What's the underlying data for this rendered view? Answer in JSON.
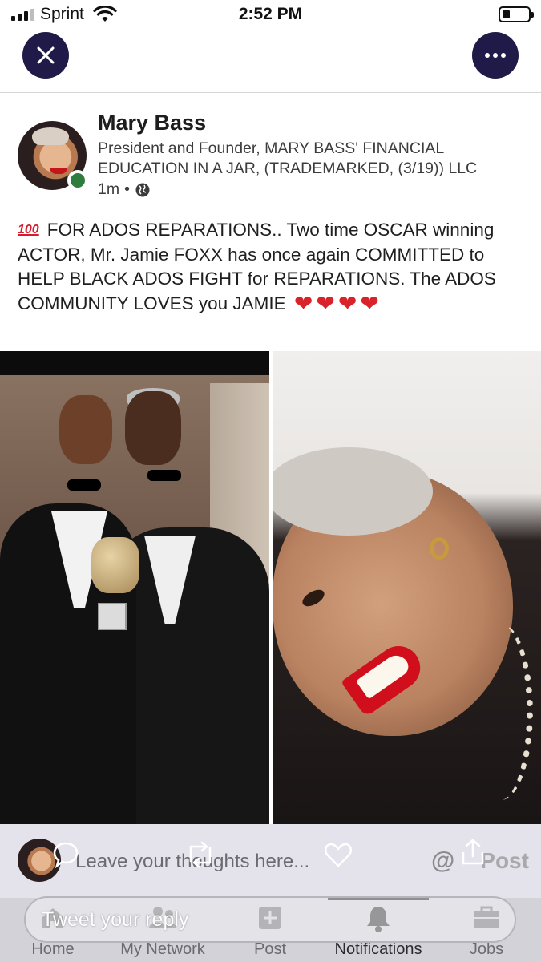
{
  "status_bar": {
    "carrier": "Sprint",
    "time": "2:52 PM",
    "icons": [
      "signal-icon",
      "wifi-icon",
      "battery-icon"
    ]
  },
  "nav": {
    "close_icon": "close-icon",
    "more_icon": "more-horizontal-icon"
  },
  "post": {
    "author": {
      "name": "Mary Bass",
      "headline": "President and Founder, MARY BASS' FINANCIAL EDUCATION IN A JAR, (TRADEMARKED, (3/19)) LLC",
      "time": "1m",
      "separator": "•",
      "visibility_icon": "globe-icon",
      "online": true
    },
    "emoji_100": "100",
    "text": "FOR ADOS REPARATIONS.. Two time OSCAR winning ACTOR, Mr. Jamie FOXX has once again COMMITTED to HELP BLACK ADOS FIGHT for REPARATIONS. The ADOS COMMUNITY LOVES you JAMIE",
    "hearts": [
      "❤",
      "❤",
      "❤",
      "❤"
    ],
    "images": [
      "photo-two-men-in-tuxedos-with-award",
      "photo-smiling-woman-closeup"
    ]
  },
  "actions": {
    "comment_placeholder": "Leave your thoughts here...",
    "mention_symbol": "@",
    "post_label": "Post",
    "icons": [
      "comment-icon",
      "retweet-icon",
      "like-heart-icon",
      "share-icon"
    ]
  },
  "reply": {
    "placeholder": "Tweet your reply"
  },
  "bottom_nav": {
    "items": [
      {
        "label": "Home",
        "icon": "home-icon"
      },
      {
        "label": "My Network",
        "icon": "people-icon"
      },
      {
        "label": "Post",
        "icon": "plus-box-icon"
      },
      {
        "label": "Notifications",
        "icon": "bell-icon",
        "active": true
      },
      {
        "label": "Jobs",
        "icon": "briefcase-icon"
      }
    ]
  },
  "colors": {
    "nav_button_bg": "#1f1a48",
    "online_dot": "#2e7d3c",
    "heart_red": "#d8232a"
  }
}
